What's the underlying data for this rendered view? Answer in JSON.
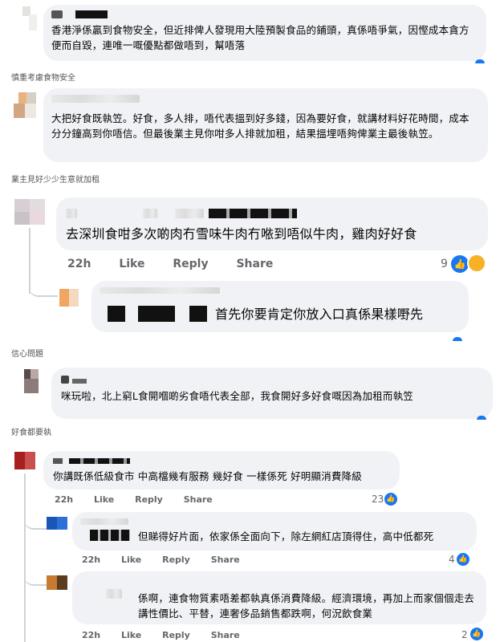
{
  "captions": {
    "c1": "慎重考慮食物安全",
    "c2": "業主見好少少生意就加租",
    "c3": "信心問題",
    "c4": "好食都要執"
  },
  "comments": {
    "c1": {
      "text": "香港淨係贏到食物安全，但近排俾人發現用大陸預製食品的鋪頭，真係唔爭氣，因慳成本貪方便而自毀，連唯一嘅優點都做唔到，幫唔落"
    },
    "c2": {
      "text": "大把好食既執笠。好食，多人排，唔代表搵到好多錢，因為要好食，就講材料好花時間，成本分分鐘高到你唔信。但最後業主見你咁多人排就加租，結果搵埋唔夠俾業主最後執笠。"
    },
    "c3": {
      "text": "去深圳食咁多次啲肉冇雪味牛肉冇𠵱到唔似牛肉，雞肉好好食",
      "time": "22h",
      "like": "Like",
      "reply": "Reply",
      "share": "Share",
      "count": "9"
    },
    "c3r": {
      "text": "首先你要肯定你放入口真係果樣嘢先"
    },
    "c4": {
      "text": "咪玩啦，北上窮L食開嗰啲劣食唔代表全部，我食開好多好食嘅因為加租而執笠"
    },
    "c5": {
      "text": "你講既係低級食市 中高檔幾有服務 幾好食 一樣係死 好明顯消費降級",
      "time": "22h",
      "like": "Like",
      "reply": "Reply",
      "share": "Share",
      "count": "23"
    },
    "c5r1": {
      "text": "但睇得好片面，依家係全面向下，除左網紅店頂得住，高中低都死",
      "time": "22h",
      "like": "Like",
      "reply": "Reply",
      "share": "Share",
      "count": "4"
    },
    "c5r2": {
      "text": "係啊，連食物質素唔差都執真係消費降級。經濟環境，再加上而家個個走去講性價比、平替，連奢侈品銷售都跌啊，何況飲食業",
      "time": "22h",
      "like": "Like",
      "reply": "Reply",
      "share": "Share",
      "count": "2"
    }
  },
  "icons": {
    "like": "like-icon",
    "haha": "haha-reaction-icon"
  },
  "colors": {
    "bubble": "#f0f2f5",
    "like_blue": "#1877f2",
    "meta_gray": "#65676b"
  }
}
